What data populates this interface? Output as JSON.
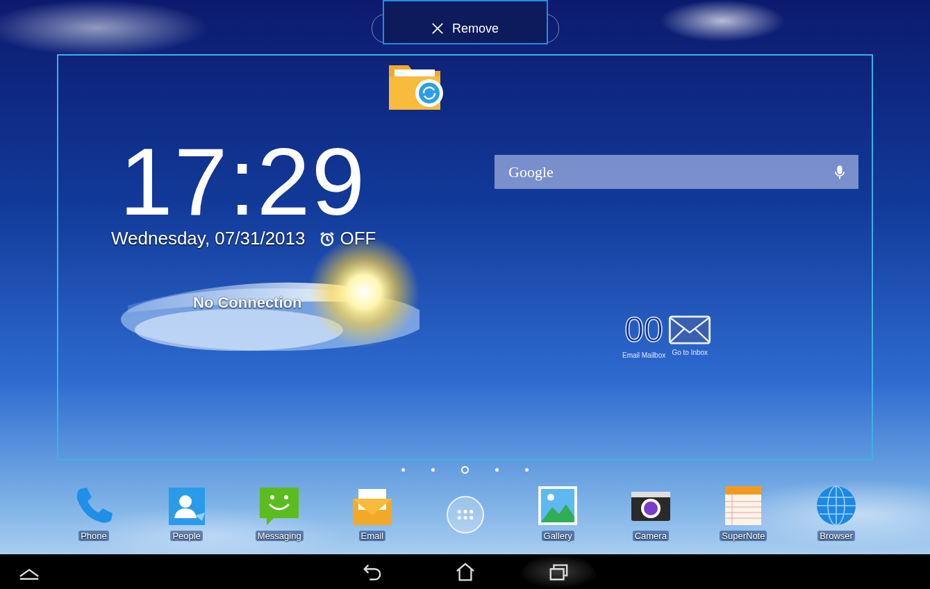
{
  "remove_bar": {
    "label": "Remove"
  },
  "clock": {
    "time": "17:29",
    "date": "Wednesday, 07/31/2013",
    "alarm": "OFF"
  },
  "weather": {
    "status": "No Connection"
  },
  "search": {
    "placeholder": "Google"
  },
  "email_widget": {
    "count": "00",
    "caption": "Email Mailbox",
    "action": "Go to Inbox"
  },
  "page_indicator": [
    {
      "selected": false
    },
    {
      "selected": false
    },
    {
      "selected": true
    },
    {
      "selected": false
    },
    {
      "selected": false
    }
  ],
  "dock": [
    {
      "kind": "phone",
      "label": "Phone"
    },
    {
      "kind": "people",
      "label": "People"
    },
    {
      "kind": "messaging",
      "label": "Messaging"
    },
    {
      "kind": "email",
      "label": "Email"
    },
    {
      "kind": "apps"
    },
    {
      "kind": "gallery",
      "label": "Gallery"
    },
    {
      "kind": "camera",
      "label": "Camera"
    },
    {
      "kind": "notes",
      "label": "SuperNote"
    },
    {
      "kind": "browser",
      "label": "Browser"
    }
  ]
}
